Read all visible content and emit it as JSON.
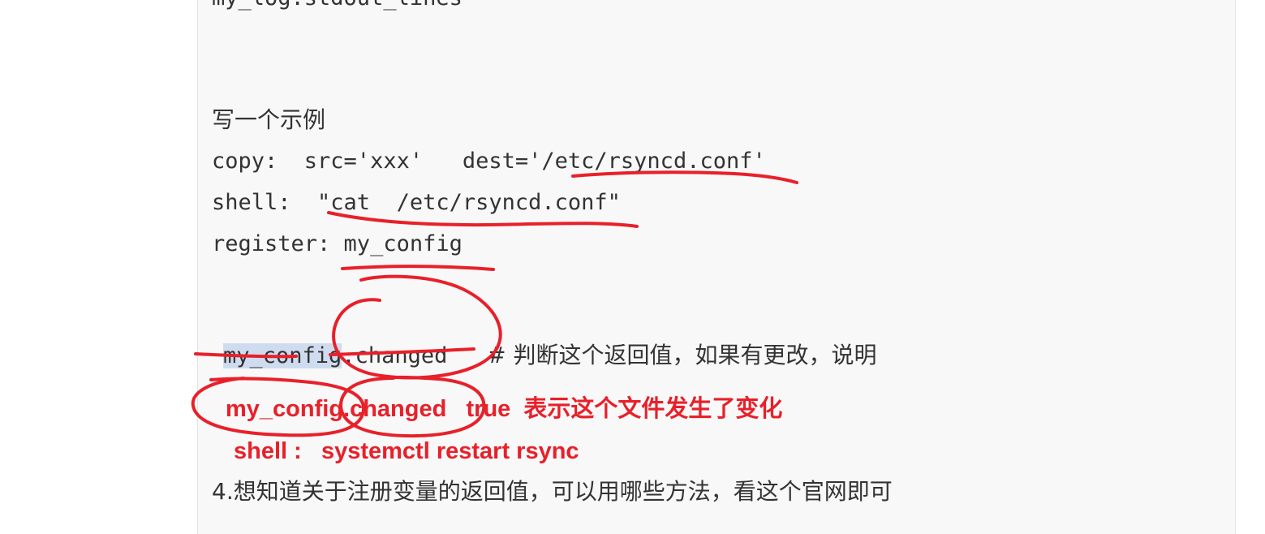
{
  "document": {
    "partial_top_line": "my_log.stdout_lines",
    "example_heading": "写一个示例",
    "copy_line": "copy:  src='xxx'   dest='/etc/rsyncd.conf'",
    "shell_line": "shell:  \"cat  /etc/rsyncd.conf\"",
    "register_line": "register: my_config",
    "changed_var_highlight": "my_config",
    "changed_var_rest": ".changed   ",
    "changed_comment": "# 判断这个返回值，如果有更改，说明",
    "step4_line": "4.想知道关于注册变量的返回值，可以用哪些方法，看这个官网即可"
  },
  "annotations": {
    "changed_true_line": "my_config.changed   true  表示这个文件发生了变化",
    "restart_line": "shell :   systemctl restart rsync"
  },
  "colors": {
    "text": "#333333",
    "annotation_red": "#e8202a",
    "highlight": "#cfdcef",
    "frame_bg": "#f8f8f8"
  }
}
